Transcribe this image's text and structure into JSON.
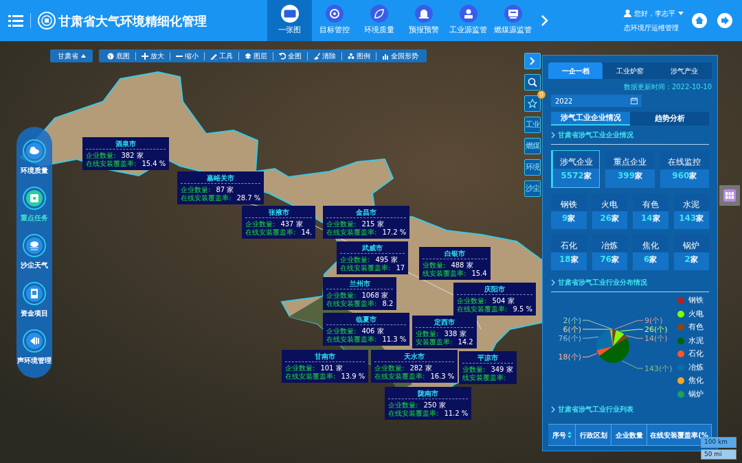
{
  "header": {
    "title": "甘肃省大气环境精细化管理",
    "nav": [
      {
        "label": "一张图",
        "selected": true
      },
      {
        "label": "目标管控",
        "selected": false
      },
      {
        "label": "环境质量",
        "selected": false
      },
      {
        "label": "预报预警",
        "selected": false
      },
      {
        "label": "工业源监管",
        "selected": false
      },
      {
        "label": "燃煤源监管",
        "selected": false
      }
    ],
    "user": {
      "greeting": "您好，李志平",
      "role": "态环境厅运维管理"
    }
  },
  "toolbar": {
    "region": "甘肃省",
    "tools": [
      "底图",
      "放大",
      "缩小",
      "工具",
      "图层",
      "全图",
      "清除",
      "图例",
      "全国形势"
    ]
  },
  "left_menu": [
    {
      "label": "环境质量",
      "selected": false
    },
    {
      "label": "重点任务",
      "selected": true
    },
    {
      "label": "沙尘天气",
      "selected": false
    },
    {
      "label": "资金项目",
      "selected": false
    },
    {
      "label": "声环境管理",
      "selected": false
    }
  ],
  "side_tools": {
    "favorites_badge": "0",
    "filters": [
      "工业",
      "燃煤",
      "环境",
      "沙尘"
    ]
  },
  "map": {
    "popups": [
      {
        "city": "酒泉市",
        "count_label": "企业数量:",
        "count": "382 家",
        "rate_label": "在线安装覆盖率:",
        "rate": "15.4 %"
      },
      {
        "city": "嘉峪关市",
        "count_label": "企业数量:",
        "count": "87 家",
        "rate_label": "在线安装覆盖率:",
        "rate": "28.7 %"
      },
      {
        "city": "张掖市",
        "count_label": "企业数量:",
        "count": "437 家",
        "rate_label": "在线安装覆盖率:",
        "rate": "14."
      },
      {
        "city": "金昌市",
        "count_label": "企业数量:",
        "count": "215 家",
        "rate_label": "在线安装覆盖率:",
        "rate": "17.2 %"
      },
      {
        "city": "武威市",
        "count_label": "企业数量:",
        "count": "495 家",
        "rate_label": "在线安装覆盖率:",
        "rate": "17"
      },
      {
        "city": "白银市",
        "count_label": "业数量:",
        "count": "488 家",
        "rate_label": "线安装覆盖率:",
        "rate": "15.4"
      },
      {
        "city": "兰州市",
        "count_label": "企业数量:",
        "count": "1068 家",
        "rate_label": "在线安装覆盖率:",
        "rate": "8.2"
      },
      {
        "city": "庆阳市",
        "count_label": "企业数量:",
        "count": "504 家",
        "rate_label": "在线安装覆盖率:",
        "rate": "9.5 %"
      },
      {
        "city": "临夏市",
        "count_label": "企业数量:",
        "count": "406 家",
        "rate_label": "在线安装覆盖率:",
        "rate": "11.3 %"
      },
      {
        "city": "定西市",
        "count_label": "业数量:",
        "count": "338 家",
        "rate_label": "安装覆盖率:",
        "rate": "14.2"
      },
      {
        "city": "甘南市",
        "count_label": "企业数量:",
        "count": "101 家",
        "rate_label": "在线安装覆盖率:",
        "rate": "13.9 %"
      },
      {
        "city": "天水市",
        "count_label": "企业数量:",
        "count": "282 家",
        "rate_label": "在线安装覆盖率:",
        "rate": "16.3 %"
      },
      {
        "city": "平凉市",
        "count_label": "业数量:",
        "count": "349 家",
        "rate_label": "线安装覆盖率:"
      },
      {
        "city": "陇南市",
        "count_label": "企业数量:",
        "count": "250 家",
        "rate_label": "在线安装覆盖率:",
        "rate": "11.2 %"
      }
    ]
  },
  "scale": {
    "metric": "100 km",
    "imperial": "50 mi"
  },
  "panel": {
    "tabs": [
      {
        "label": "一企一档",
        "selected": true
      },
      {
        "label": "工业炉窑",
        "selected": false
      },
      {
        "label": "涉气产业",
        "selected": false
      }
    ],
    "update_time": "数据更新时间：2022-10-10",
    "year": "2022",
    "subtabs": [
      {
        "label": "涉气工业企业情况",
        "selected": true
      },
      {
        "label": "趋势分析",
        "selected": false
      }
    ],
    "section_1": "甘肃省涉气工业企业情况",
    "summary": [
      {
        "label": "涉气企业",
        "value": "5572",
        "unit": "家",
        "selected": true
      },
      {
        "label": "重点企业",
        "value": "399",
        "unit": "家",
        "selected": false
      },
      {
        "label": "在线监控",
        "value": "960",
        "unit": "家",
        "selected": false
      }
    ],
    "industries": [
      {
        "label": "钢铁",
        "value": "9",
        "unit": "家"
      },
      {
        "label": "火电",
        "value": "26",
        "unit": "家"
      },
      {
        "label": "有色",
        "value": "14",
        "unit": "家"
      },
      {
        "label": "水泥",
        "value": "143",
        "unit": "家"
      },
      {
        "label": "石化",
        "value": "18",
        "unit": "家"
      },
      {
        "label": "冶炼",
        "value": "76",
        "unit": "家"
      },
      {
        "label": "焦化",
        "value": "6",
        "unit": "家"
      },
      {
        "label": "锅炉",
        "value": "2",
        "unit": "家"
      }
    ],
    "section_2": "甘肃省涉气工业行业分布情况",
    "chart_data": {
      "type": "pie",
      "categories": [
        "钢铁",
        "火电",
        "有色",
        "水泥",
        "石化",
        "冶炼",
        "焦化",
        "锅炉"
      ],
      "values": [
        9,
        26,
        14,
        143,
        18,
        76,
        6,
        2
      ],
      "value_labels": [
        "9(个)",
        "26(个)",
        "14(个)",
        "143(个)",
        "18(个)",
        "76(个)",
        "6(个)",
        "2(个)"
      ]
    },
    "legend": [
      {
        "color": "#b22222"
      },
      {
        "color": "#7fff00"
      },
      {
        "color": "#8b4513"
      },
      {
        "color": "#006400"
      },
      {
        "color": "#ff5722"
      },
      {
        "color": "#0a6fa8"
      },
      {
        "color": "#f5a623"
      },
      {
        "color": "#1aa35a"
      }
    ],
    "section_3": "甘肃省涉气工业行业列表",
    "table": {
      "columns": [
        "序号",
        "行政区划",
        "企业数量",
        "在线安装覆盖率(%"
      ]
    }
  }
}
